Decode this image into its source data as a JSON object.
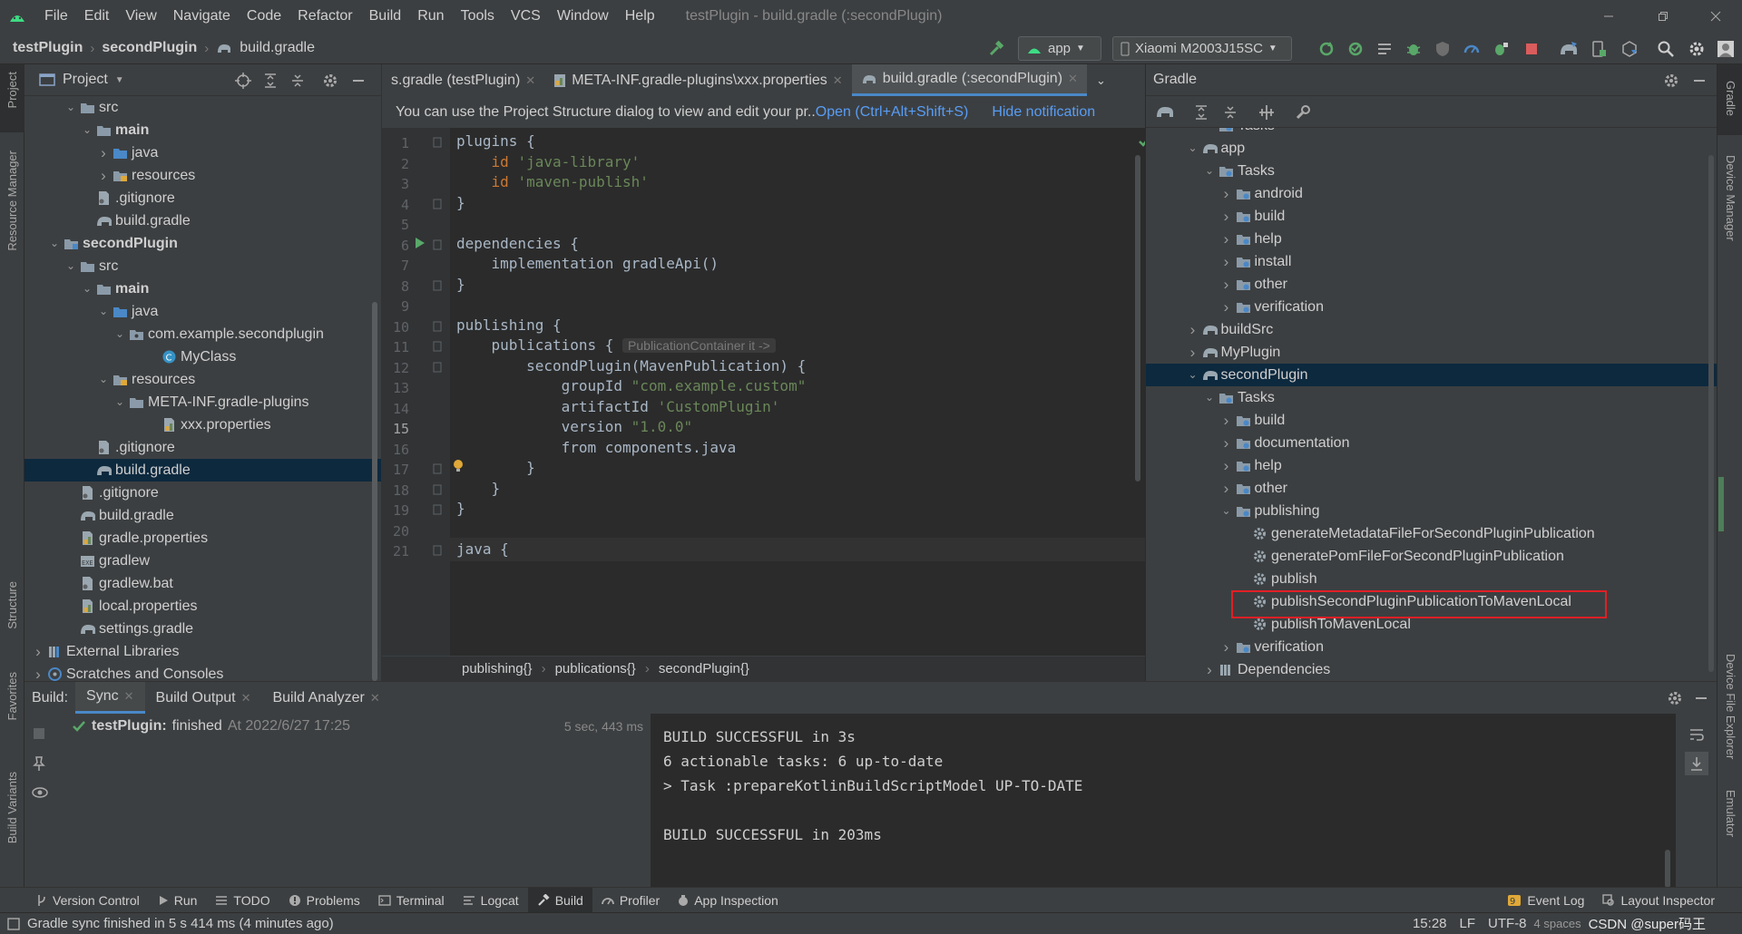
{
  "menubar": {
    "items": [
      "File",
      "Edit",
      "View",
      "Navigate",
      "Code",
      "Refactor",
      "Build",
      "Run",
      "Tools",
      "VCS",
      "Window",
      "Help"
    ],
    "window_title": "testPlugin - build.gradle (:secondPlugin)"
  },
  "navbar": {
    "crumbs": [
      "testPlugin",
      "secondPlugin",
      "build.gradle"
    ],
    "run_config": "app",
    "device": "Xiaomi M2003J15SC"
  },
  "left_stripe": [
    "Project",
    "Resource Manager",
    "Structure",
    "Favorites",
    "Build Variants"
  ],
  "right_stripe": [
    "Gradle",
    "Device Manager",
    "Device File Explorer",
    "Emulator"
  ],
  "project": {
    "title": "Project",
    "tree": [
      {
        "label": "src",
        "icon": "folder",
        "arrow": "down",
        "level": 2
      },
      {
        "label": "main",
        "icon": "folder",
        "arrow": "down",
        "level": 3,
        "bold": true
      },
      {
        "label": "java",
        "icon": "folder-blue",
        "arrow": "right",
        "level": 4
      },
      {
        "label": "resources",
        "icon": "folder-res",
        "arrow": "right",
        "level": 4
      },
      {
        "label": ".gitignore",
        "icon": "file",
        "arrow": "",
        "level": 3
      },
      {
        "label": "build.gradle",
        "icon": "gradle",
        "arrow": "",
        "level": 3
      },
      {
        "label": "secondPlugin",
        "icon": "folder-module",
        "arrow": "down",
        "level": 1,
        "bold": true
      },
      {
        "label": "src",
        "icon": "folder",
        "arrow": "down",
        "level": 2
      },
      {
        "label": "main",
        "icon": "folder",
        "arrow": "down",
        "level": 3,
        "bold": true
      },
      {
        "label": "java",
        "icon": "folder-blue",
        "arrow": "down",
        "level": 4
      },
      {
        "label": "com.example.secondplugin",
        "icon": "package",
        "arrow": "down",
        "level": 5
      },
      {
        "label": "MyClass",
        "icon": "class",
        "arrow": "",
        "level": 7
      },
      {
        "label": "resources",
        "icon": "folder-res",
        "arrow": "down",
        "level": 4
      },
      {
        "label": "META-INF.gradle-plugins",
        "icon": "folder",
        "arrow": "down",
        "level": 5
      },
      {
        "label": "xxx.properties",
        "icon": "props",
        "arrow": "",
        "level": 7
      },
      {
        "label": ".gitignore",
        "icon": "file",
        "arrow": "",
        "level": 3
      },
      {
        "label": "build.gradle",
        "icon": "gradle",
        "arrow": "",
        "level": 3,
        "selected": true
      },
      {
        "label": ".gitignore",
        "icon": "file",
        "arrow": "",
        "level": 2
      },
      {
        "label": "build.gradle",
        "icon": "gradle",
        "arrow": "",
        "level": 2
      },
      {
        "label": "gradle.properties",
        "icon": "props",
        "arrow": "",
        "level": 2
      },
      {
        "label": "gradlew",
        "icon": "exec",
        "arrow": "",
        "level": 2
      },
      {
        "label": "gradlew.bat",
        "icon": "file",
        "arrow": "",
        "level": 2
      },
      {
        "label": "local.properties",
        "icon": "props",
        "arrow": "",
        "level": 2
      },
      {
        "label": "settings.gradle",
        "icon": "gradle",
        "arrow": "",
        "level": 2
      },
      {
        "label": "External Libraries",
        "icon": "libs",
        "arrow": "right",
        "level": 0
      },
      {
        "label": "Scratches and Consoles",
        "icon": "scratch",
        "arrow": "right",
        "level": 0
      }
    ]
  },
  "editor": {
    "tabs": [
      {
        "label": "s.gradle (testPlugin)",
        "active": false
      },
      {
        "label": "META-INF.gradle-plugins\\xxx.properties",
        "active": false
      },
      {
        "label": "build.gradle (:secondPlugin)",
        "active": true
      }
    ],
    "notification": {
      "text": "You can use the Project Structure dialog to view and edit your pr..",
      "link1": "Open (Ctrl+Alt+Shift+S)",
      "link2": "Hide notification"
    },
    "line_numbers": [
      "1",
      "2",
      "3",
      "4",
      "5",
      "6",
      "7",
      "8",
      "9",
      "10",
      "11",
      "12",
      "13",
      "14",
      "15",
      "16",
      "17",
      "18",
      "19",
      "20",
      "21"
    ],
    "code": {
      "l1": "plugins {",
      "l2_kw": "id",
      "l2_str": "'java-library'",
      "l3_kw": "id",
      "l3_str": "'maven-publish'",
      "l4": "}",
      "l6": "dependencies {",
      "l7": "implementation gradleApi()",
      "l8": "}",
      "l10": "publishing {",
      "l11": "publications {",
      "l11_hint": "PublicationContainer it ->",
      "l12": "secondPlugin(MavenPublication) {",
      "l13_kw": "groupId",
      "l13_str": "\"com.example.custom\"",
      "l14_kw": "artifactId",
      "l14_str": "'CustomPlugin'",
      "l15_kw": "version",
      "l15_str": "\"1.0.0\"",
      "l16": "from components.java",
      "l17": "}",
      "l18": "}",
      "l19": "}",
      "l21": "java {"
    },
    "breadcrumbs": [
      "publishing{}",
      "publications{}",
      "secondPlugin{}"
    ]
  },
  "gradle": {
    "title": "Gradle",
    "tree": [
      {
        "label": "Tasks",
        "icon": "tasks",
        "arrow": "right",
        "level": 2,
        "partial": true
      },
      {
        "label": "app",
        "icon": "gradle",
        "arrow": "down",
        "level": 1
      },
      {
        "label": "Tasks",
        "icon": "tasks",
        "arrow": "down",
        "level": 2
      },
      {
        "label": "android",
        "icon": "tasks",
        "arrow": "right",
        "level": 3
      },
      {
        "label": "build",
        "icon": "tasks",
        "arrow": "right",
        "level": 3
      },
      {
        "label": "help",
        "icon": "tasks",
        "arrow": "right",
        "level": 3
      },
      {
        "label": "install",
        "icon": "tasks",
        "arrow": "right",
        "level": 3
      },
      {
        "label": "other",
        "icon": "tasks",
        "arrow": "right",
        "level": 3
      },
      {
        "label": "verification",
        "icon": "tasks",
        "arrow": "right",
        "level": 3
      },
      {
        "label": "buildSrc",
        "icon": "gradle",
        "arrow": "right",
        "level": 1
      },
      {
        "label": "MyPlugin",
        "icon": "gradle",
        "arrow": "right",
        "level": 1
      },
      {
        "label": "secondPlugin",
        "icon": "gradle",
        "arrow": "down",
        "level": 1,
        "selected": true
      },
      {
        "label": "Tasks",
        "icon": "tasks",
        "arrow": "down",
        "level": 2
      },
      {
        "label": "build",
        "icon": "tasks",
        "arrow": "right",
        "level": 3
      },
      {
        "label": "documentation",
        "icon": "tasks",
        "arrow": "right",
        "level": 3
      },
      {
        "label": "help",
        "icon": "tasks",
        "arrow": "right",
        "level": 3
      },
      {
        "label": "other",
        "icon": "tasks",
        "arrow": "right",
        "level": 3
      },
      {
        "label": "publishing",
        "icon": "tasks",
        "arrow": "down",
        "level": 3
      },
      {
        "label": "generateMetadataFileForSecondPluginPublication",
        "icon": "gear",
        "arrow": "",
        "level": 4
      },
      {
        "label": "generatePomFileForSecondPluginPublication",
        "icon": "gear",
        "arrow": "",
        "level": 4
      },
      {
        "label": "publish",
        "icon": "gear",
        "arrow": "",
        "level": 4
      },
      {
        "label": "publishSecondPluginPublicationToMavenLocal",
        "icon": "gear",
        "arrow": "",
        "level": 4
      },
      {
        "label": "publishToMavenLocal",
        "icon": "gear",
        "arrow": "",
        "level": 4
      },
      {
        "label": "verification",
        "icon": "tasks",
        "arrow": "right",
        "level": 3
      },
      {
        "label": "Dependencies",
        "icon": "deps",
        "arrow": "right",
        "level": 2
      }
    ]
  },
  "build": {
    "label": "Build:",
    "tabs": [
      {
        "label": "Sync",
        "active": true
      },
      {
        "label": "Build Output",
        "active": false
      },
      {
        "label": "Build Analyzer",
        "active": false
      }
    ],
    "sync_item": {
      "project": "testPlugin:",
      "status": "finished",
      "when": "At 2022/6/27 17:25",
      "duration": "5 sec, 443 ms"
    },
    "output": [
      "BUILD SUCCESSFUL in 3s",
      "6 actionable tasks: 6 up-to-date",
      "> Task :prepareKotlinBuildScriptModel UP-TO-DATE",
      "",
      "BUILD SUCCESSFUL in 203ms"
    ]
  },
  "bottom_tools": {
    "left": [
      "Version Control",
      "Run",
      "TODO",
      "Problems",
      "Terminal",
      "Logcat",
      "Build",
      "Profiler",
      "App Inspection"
    ],
    "right": [
      "Event Log",
      "Layout Inspector"
    ]
  },
  "status": {
    "message": "Gradle sync finished in 5 s 414 ms (4 minutes ago)",
    "position": "15:28",
    "line_sep": "LF",
    "encoding": "UTF-8",
    "indent": "4 spaces",
    "watermark": "CSDN @super码王"
  },
  "colors": {
    "accent": "#4a88c7",
    "selection": "#0d293e",
    "highlight_box": "#e21f26",
    "success": "#59a869"
  }
}
